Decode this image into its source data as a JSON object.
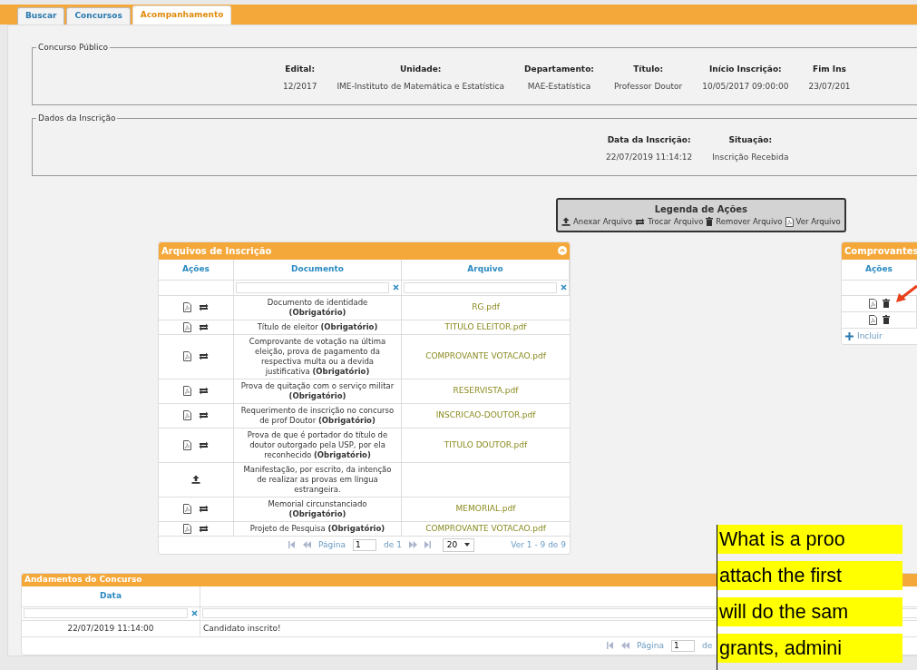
{
  "tabs": [
    {
      "label": "Buscar",
      "selected": false
    },
    {
      "label": "Concursos",
      "selected": false
    },
    {
      "label": "Acompanhamento",
      "selected": true
    }
  ],
  "concurso": {
    "legend": "Concurso Público",
    "fields": [
      {
        "label": "Edital:",
        "value": "12/2017"
      },
      {
        "label": "Unidade:",
        "value": "IME-Instituto de Matemática e Estatística"
      },
      {
        "label": "Departamento:",
        "value": "MAE-Estatística"
      },
      {
        "label": "Título:",
        "value": "Professor Doutor"
      },
      {
        "label": "Início Inscrição:",
        "value": "10/05/2017 09:00:00"
      },
      {
        "label": "Fim Ins",
        "value": "23/07/201"
      }
    ]
  },
  "inscricao": {
    "legend": "Dados da Inscrição",
    "fields": [
      {
        "label": "Data da Inscrição:",
        "value": "22/07/2019 11:14:12"
      },
      {
        "label": "Situação:",
        "value": "Inscrição Recebida"
      }
    ]
  },
  "legend_box": {
    "title": "Legenda de Ações",
    "items": [
      {
        "kind": "upload",
        "label": "Anexar Arquivo"
      },
      {
        "kind": "swap",
        "label": "Trocar Arquivo"
      },
      {
        "kind": "trash",
        "label": "Remover Arquivo"
      },
      {
        "kind": "pdf",
        "label": "Ver Arquivo"
      }
    ]
  },
  "arquivos": {
    "title": "Arquivos de Inscrição",
    "columns": [
      "Ações",
      "Documento",
      "Arquivo"
    ],
    "rows": [
      {
        "actions": [
          {
            "kind": "pdf"
          },
          {
            "kind": "swap"
          }
        ],
        "document": "Documento de identidade **(Obrigatório)**",
        "file": "RG.pdf"
      },
      {
        "actions": [
          {
            "kind": "pdf"
          },
          {
            "kind": "swap"
          }
        ],
        "document": "Título de eleitor **(Obrigatório)**",
        "file": "TITULO ELEITOR.pdf"
      },
      {
        "actions": [
          {
            "kind": "pdf"
          },
          {
            "kind": "swap"
          }
        ],
        "document": "Comprovante de votação na última eleição, prova de pagamento da respectiva multa ou a devida justificativa **(Obrigatório)**",
        "file": "COMPROVANTE VOTACAO.pdf"
      },
      {
        "actions": [
          {
            "kind": "pdf"
          },
          {
            "kind": "swap"
          }
        ],
        "document": "Prova de quitação com o serviço militar **(Obrigatório)**",
        "file": "RESERVISTA.pdf"
      },
      {
        "actions": [
          {
            "kind": "pdf"
          },
          {
            "kind": "swap"
          }
        ],
        "document": "Requerimento de inscrição no concurso de prof Doutor **(Obrigatório)**",
        "file": "INSCRICAO-DOUTOR.pdf"
      },
      {
        "actions": [
          {
            "kind": "pdf"
          },
          {
            "kind": "swap"
          }
        ],
        "document": "Prova de que é portador do título de doutor outorgado pela USP, por ela reconhecido **(Obrigatório)**",
        "file": "TITULO DOUTOR.pdf"
      },
      {
        "actions": [
          {
            "kind": "upload"
          }
        ],
        "document": "Manifestação, por escrito, da intenção de realizar as provas em língua estrangeira.",
        "file": ""
      },
      {
        "actions": [
          {
            "kind": "pdf"
          },
          {
            "kind": "swap"
          }
        ],
        "document": "Memorial circunstanciado **(Obrigatório)**",
        "file": "MEMORIAL.pdf"
      },
      {
        "actions": [
          {
            "kind": "pdf"
          },
          {
            "kind": "swap"
          }
        ],
        "document": "Projeto de Pesquisa **(Obrigatório)**",
        "file": "COMPROVANTE VOTACAO.pdf"
      }
    ],
    "pager": {
      "page_label": "Página",
      "page": "1",
      "of": "de 1",
      "size": "20",
      "summary": "Ver 1 - 9 de 9"
    }
  },
  "comprovantes": {
    "title": "Comprovantes",
    "columns": [
      "Ações"
    ],
    "rows": [
      {
        "actions": [
          {
            "kind": "pdf"
          },
          {
            "kind": "trash"
          }
        ]
      },
      {
        "actions": [
          {
            "kind": "pdf"
          },
          {
            "kind": "trash"
          }
        ]
      }
    ],
    "add_label": "Incluir"
  },
  "andamentos": {
    "title": "Andamentos do Concurso",
    "columns": [
      "Data"
    ],
    "rows": [
      {
        "date": "22/07/2019 11:14:00",
        "text": "Candidato inscrito!"
      }
    ],
    "pager": {
      "page_label": "Página",
      "page": "1",
      "of": "de"
    }
  },
  "note": {
    "lines": [
      "What is a proo",
      "attach the first",
      "will do the sam",
      "grants, admini"
    ]
  }
}
